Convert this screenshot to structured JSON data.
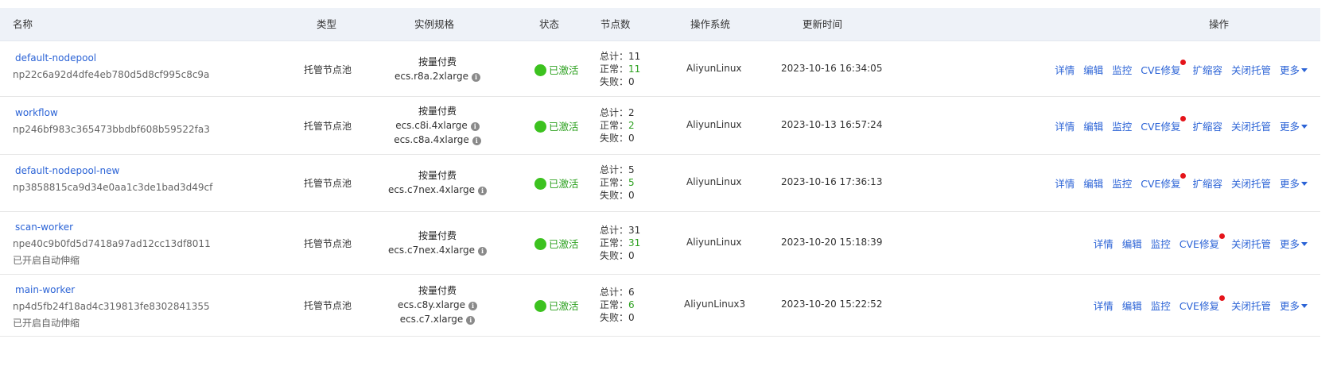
{
  "columns": {
    "name": "名称",
    "type": "类型",
    "spec": "实例规格",
    "status": "状态",
    "nodes": "节点数",
    "os": "操作系统",
    "updated": "更新时间",
    "actions": "操作"
  },
  "labels": {
    "total": "总计：",
    "normal": "正常：",
    "failed": "失败：",
    "info_glyph": "i"
  },
  "rows": [
    {
      "name": "default-nodepool",
      "id": "np22c6a92d4dfe4eb780d5d8cf995c8c9a",
      "note": "",
      "type": "托管节点池",
      "billing": "按量付费",
      "specs": [
        "ecs.r8a.2xlarge"
      ],
      "status": "已激活",
      "total": "11",
      "normal": "11",
      "failed": "0",
      "os": "AliyunLinux",
      "updated": "2023-10-16 16:34:05",
      "actions": [
        "详情",
        "编辑",
        "监控",
        "CVE修复",
        "扩缩容",
        "关闭托管",
        "更多"
      ]
    },
    {
      "name": "workflow",
      "id": "np246bf983c365473bbdbf608b59522fa3",
      "note": "",
      "type": "托管节点池",
      "billing": "按量付费",
      "specs": [
        "ecs.c8i.4xlarge",
        "ecs.c8a.4xlarge"
      ],
      "status": "已激活",
      "total": "2",
      "normal": "2",
      "failed": "0",
      "os": "AliyunLinux",
      "updated": "2023-10-13 16:57:24",
      "actions": [
        "详情",
        "编辑",
        "监控",
        "CVE修复",
        "扩缩容",
        "关闭托管",
        "更多"
      ]
    },
    {
      "name": "default-nodepool-new",
      "id": "np3858815ca9d34e0aa1c3de1bad3d49cf",
      "note": "",
      "type": "托管节点池",
      "billing": "按量付费",
      "specs": [
        "ecs.c7nex.4xlarge"
      ],
      "status": "已激活",
      "total": "5",
      "normal": "5",
      "failed": "0",
      "os": "AliyunLinux",
      "updated": "2023-10-16 17:36:13",
      "actions": [
        "详情",
        "编辑",
        "监控",
        "CVE修复",
        "扩缩容",
        "关闭托管",
        "更多"
      ]
    },
    {
      "name": "scan-worker",
      "id": "npe40c9b0fd5d7418a97ad12cc13df8011",
      "note": "已开启自动伸缩",
      "type": "托管节点池",
      "billing": "按量付费",
      "specs": [
        "ecs.c7nex.4xlarge"
      ],
      "status": "已激活",
      "total": "31",
      "normal": "31",
      "failed": "0",
      "os": "AliyunLinux",
      "updated": "2023-10-20 15:18:39",
      "actions": [
        "详情",
        "编辑",
        "监控",
        "CVE修复",
        "关闭托管",
        "更多"
      ]
    },
    {
      "name": "main-worker",
      "id": "np4d5fb24f18ad4c319813fe8302841355",
      "note": "已开启自动伸缩",
      "type": "托管节点池",
      "billing": "按量付费",
      "specs": [
        "ecs.c8y.xlarge",
        "ecs.c7.xlarge"
      ],
      "status": "已激活",
      "total": "6",
      "normal": "6",
      "failed": "0",
      "os": "AliyunLinux3",
      "updated": "2023-10-20 15:22:52",
      "actions": [
        "详情",
        "编辑",
        "监控",
        "CVE修复",
        "关闭托管",
        "更多"
      ]
    }
  ],
  "colors": {
    "link": "#2b63d6",
    "status_green": "#2ea121",
    "status_dot": "#3cc21f",
    "alert_dot": "#e5141a",
    "header_bg": "#eef2f8"
  }
}
